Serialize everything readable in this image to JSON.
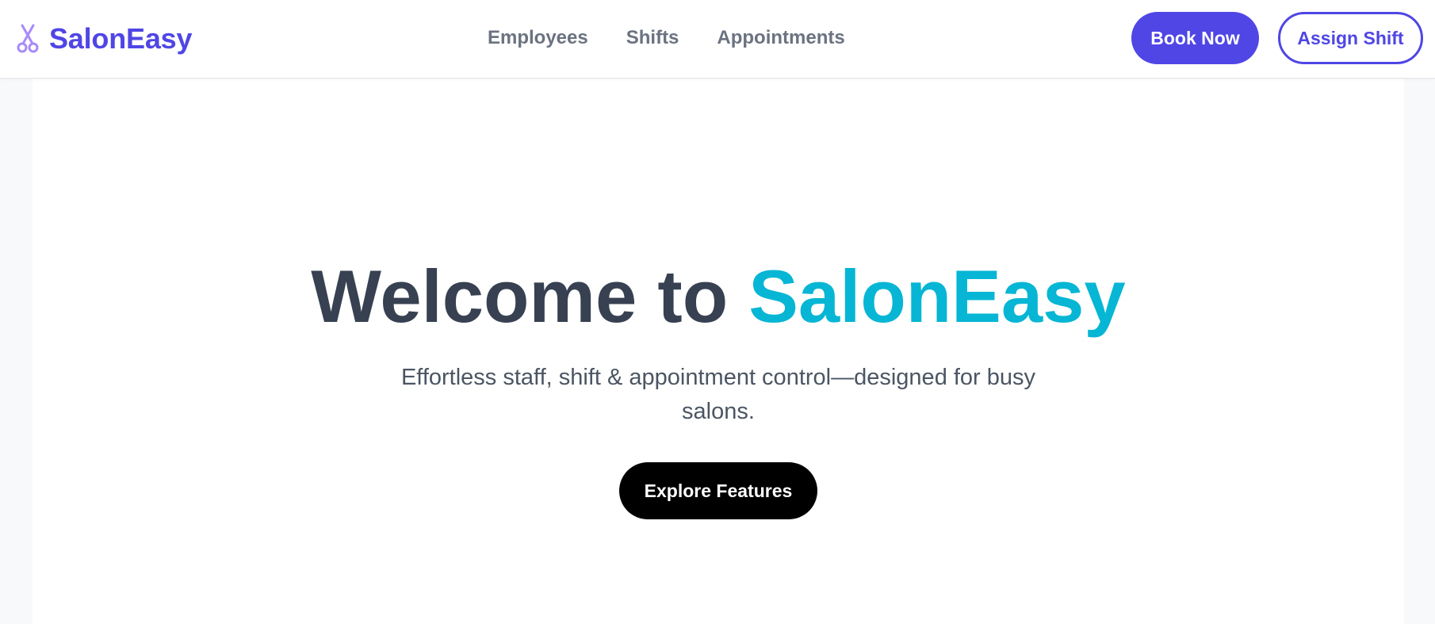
{
  "navbar": {
    "brand": {
      "icon": "scissors-icon",
      "name": "SalonEasy"
    },
    "links": [
      {
        "label": "Employees"
      },
      {
        "label": "Shifts"
      },
      {
        "label": "Appointments"
      }
    ],
    "book_label": "Book Now",
    "assign_label": "Assign Shift"
  },
  "hero": {
    "title_prefix": "Welcome to ",
    "title_accent": "SalonEasy",
    "subtitle": "Effortless staff, shift & appointment control—designed for busy salons.",
    "cta_label": "Explore Features"
  },
  "colors": {
    "brand": "#4f46e5",
    "accent": "#06b6d4",
    "title": "#374151",
    "cta": "#000000"
  }
}
